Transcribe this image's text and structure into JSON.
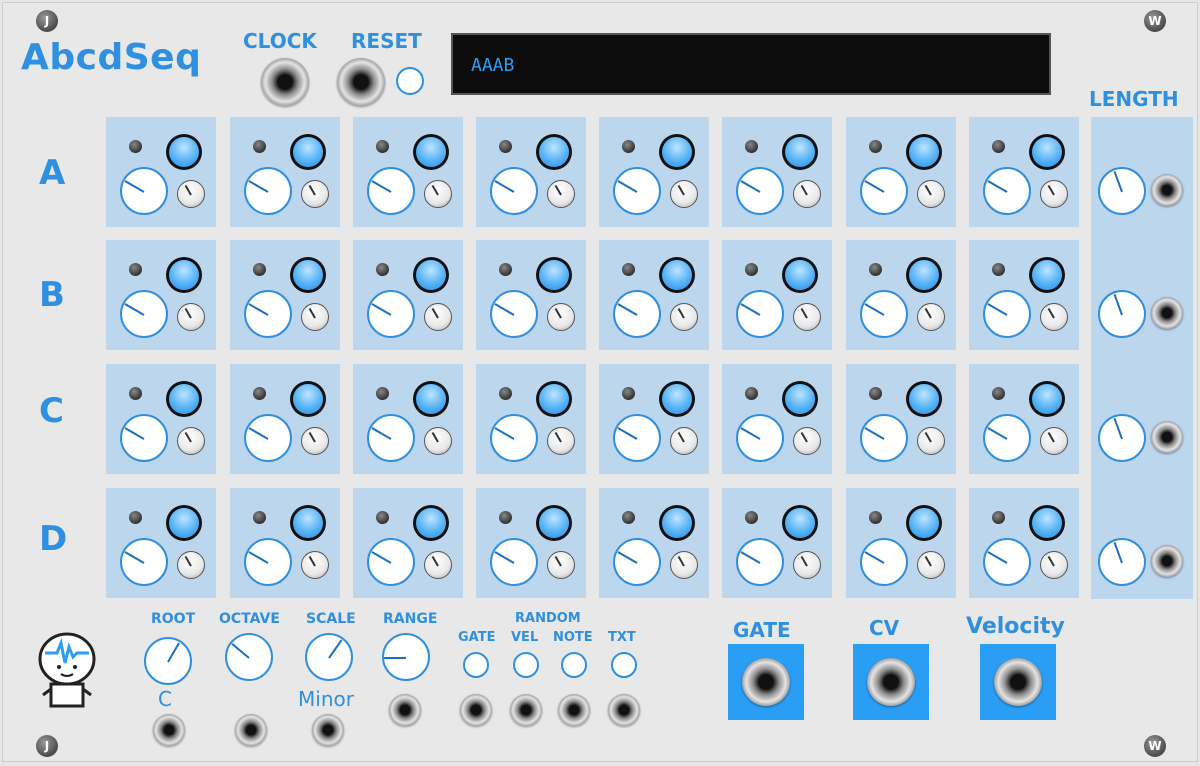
{
  "module": {
    "title": "AbcdSeq",
    "screw_top_left": "J",
    "screw_top_right": "W",
    "screw_bottom_left": "J",
    "screw_bottom_right": "W"
  },
  "header": {
    "clock_label": "CLOCK",
    "reset_label": "RESET",
    "display_text": "AAAB"
  },
  "length_label": "LENGTH",
  "rows": [
    "A",
    "B",
    "C",
    "D"
  ],
  "steps_per_row": 8,
  "controls": {
    "root_label": "ROOT",
    "root_value": "C",
    "octave_label": "OCTAVE",
    "scale_label": "SCALE",
    "scale_value": "Minor",
    "range_label": "RANGE",
    "random_label": "RANDOM",
    "random_gate": "GATE",
    "random_vel": "VEL",
    "random_note": "NOTE",
    "random_txt": "TXT"
  },
  "outputs": {
    "gate": "GATE",
    "cv": "CV",
    "velocity": "Velocity"
  },
  "colors": {
    "accent": "#2f8fe0",
    "cell_bg": "#bcd6ee",
    "output_bg": "#2a9df4",
    "display_text": "#2a9df4"
  }
}
